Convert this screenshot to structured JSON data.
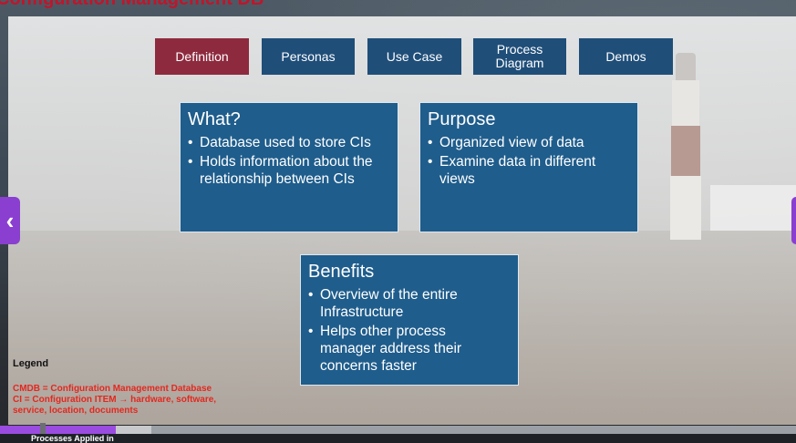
{
  "page": {
    "title": "Configuration Management DB"
  },
  "tabs": [
    {
      "label": "Definition",
      "active": true
    },
    {
      "label": "Personas",
      "active": false
    },
    {
      "label": "Use Case",
      "active": false
    },
    {
      "label": "Process Diagram",
      "active": false
    },
    {
      "label": "Demos",
      "active": false
    }
  ],
  "boxes": {
    "what": {
      "title": "What?",
      "bullets": [
        "Database used to store CIs",
        "Holds information about the relationship between CIs"
      ]
    },
    "purpose": {
      "title": "Purpose",
      "bullets": [
        "Organized view of data",
        "Examine data in different views"
      ]
    },
    "benefits": {
      "title": "Benefits",
      "bullets": [
        "Overview of the entire Infrastructure",
        "Helps other process manager address their concerns faster"
      ]
    }
  },
  "legend": {
    "title": "Legend",
    "lines": [
      "CMDB = Configuration Management Database",
      "CI = Configuration ITEM → hardware, software,",
      "service, location, documents"
    ]
  },
  "nav": {
    "prev_icon": "chevron-left-icon",
    "next_icon": "chevron-right-icon",
    "prev_glyph": "‹"
  },
  "player": {
    "progress": 0.145,
    "buffered": 0.19,
    "caption": "Processes Applied in"
  },
  "colors": {
    "tab_active": "#8e2a3e",
    "tab": "#1f4e79",
    "box": "#1f5d8c",
    "accent": "#9b4ce0",
    "legend_text": "#e3281f"
  }
}
